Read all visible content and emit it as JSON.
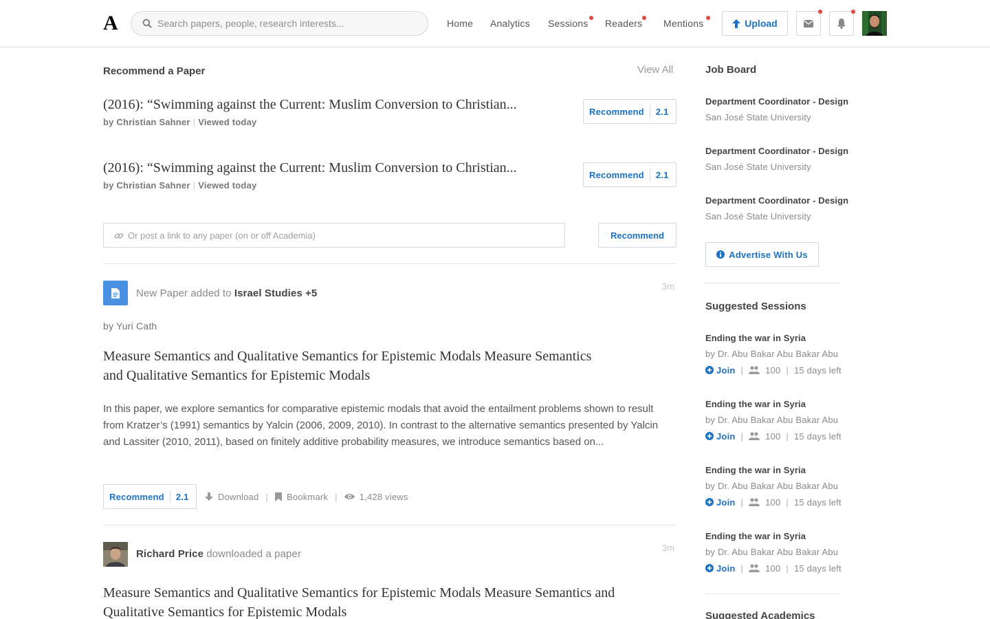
{
  "header": {
    "logo": "A",
    "search_placeholder": "Search papers, people, research interests...",
    "nav": [
      "Home",
      "Analytics",
      "Sessions",
      "Readers",
      "Mentions"
    ],
    "upload_label": "Upload"
  },
  "recommend": {
    "title": "Recommend a Paper",
    "view_all": "View All",
    "items": [
      {
        "title": "(2016): “Swimming against the Current: Muslim Conversion to Christian...",
        "author": "by Christian Sahner",
        "viewed": "Viewed today",
        "button": "Recommend",
        "score": "2.1"
      },
      {
        "title": "(2016): “Swimming against the Current: Muslim Conversion to Christian...",
        "author": "by Christian Sahner",
        "viewed": "Viewed today",
        "button": "Recommend",
        "score": "2.1"
      }
    ],
    "link_placeholder": "Or post a link to any paper (on or off Academia)",
    "post_button": "Recommend"
  },
  "feed": [
    {
      "head_prefix": "New Paper added to",
      "head_target": "Israel Studies +5",
      "time": "3m",
      "by": "by Yuri Cath",
      "title_line1": "Measure Semantics and Qualitative Semantics for Epistemic Modals Measure Semantics",
      "title_line2": "and Qualitative Semantics for Epistemic Modals",
      "abstract": "In this paper, we explore semantics for comparative epistemic modals that avoid the entailment problems shown to result from Kratzer’s (1991) semantics by Yalcin (2006, 2009, 2010). In contrast to the alternative semantics presented by Yalcin and Lassiter (2010, 2011), based on finitely additive probability measures, we introduce semantics based on...",
      "recommend_label": "Recommend",
      "score": "2.1",
      "download": "Download",
      "bookmark": "Bookmark",
      "views": "1,428 views"
    },
    {
      "head_name": "Richard Price",
      "head_action": "downloaded a paper",
      "time": "3m",
      "title_line1": "Measure Semantics and Qualitative Semantics for Epistemic Modals Measure Semantics and",
      "title_line2": "Qualitative Semantics for Epistemic Modals"
    }
  ],
  "sidebar": {
    "job_board_title": "Job Board",
    "jobs": [
      {
        "title": "Department Coordinator - Design",
        "school": "San José State University"
      },
      {
        "title": "Department Coordinator - Design",
        "school": "San José State University"
      },
      {
        "title": "Department Coordinator - Design",
        "school": "San José State University"
      }
    ],
    "advertise": "Advertise With Us",
    "sessions_title": "Suggested Sessions",
    "sessions": [
      {
        "title": "Ending the war in Syria",
        "by": "by Dr. Abu Bakar Abu Bakar Abu",
        "join": "Join",
        "count": "100",
        "left": "15 days left"
      },
      {
        "title": "Ending the war in Syria",
        "by": "by Dr. Abu Bakar Abu Bakar Abu",
        "join": "Join",
        "count": "100",
        "left": "15 days left"
      },
      {
        "title": "Ending the war in Syria",
        "by": "by Dr. Abu Bakar Abu Bakar Abu",
        "join": "Join",
        "count": "100",
        "left": "15 days left"
      },
      {
        "title": "Ending the war in Syria",
        "by": "by Dr. Abu Bakar Abu Bakar Abu",
        "join": "Join",
        "count": "100",
        "left": "15 days left"
      }
    ],
    "academics_title": "Suggested Academics"
  },
  "icons": {
    "search": "search-icon",
    "upload": "arrow-up-icon",
    "mail": "envelope-icon",
    "bell": "bell-icon",
    "link": "link-icon",
    "doc": "document-icon",
    "download": "download-icon",
    "bookmark": "bookmark-icon",
    "views": "eye-icon",
    "info": "info-icon",
    "join": "plus-circle-icon",
    "group": "users-icon"
  },
  "colors": {
    "accent": "#1b72c4",
    "notification_dot": "#e2483d",
    "doc_icon_bg": "#4a90e2"
  }
}
